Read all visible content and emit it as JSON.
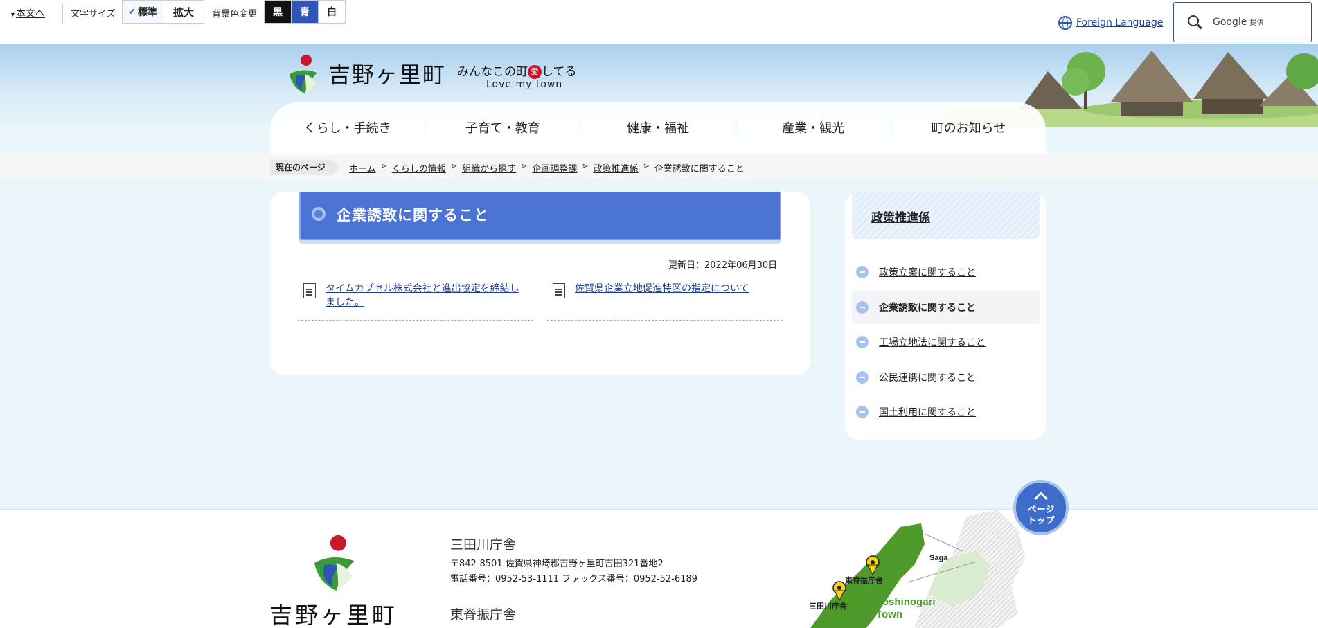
{
  "utility": {
    "skip": "本文へ",
    "font_size_label": "文字サイズ",
    "font_std": "標準",
    "font_big": "拡大",
    "bg_label": "背景色変更",
    "bg_black": "黒",
    "bg_blue": "青",
    "bg_white": "白",
    "foreign": "Foreign Language",
    "search_brand": "Google",
    "search_provided": "提供"
  },
  "header": {
    "logo": "吉野ヶ里町",
    "slogan_pre": "みんなこの町",
    "slogan_heart": "愛",
    "slogan_post": "してる",
    "slogan_en": "Love my town"
  },
  "nav": {
    "items": [
      {
        "label": "くらし・手続き"
      },
      {
        "label": "子育て・教育"
      },
      {
        "label": "健康・福祉"
      },
      {
        "label": "産業・観光"
      },
      {
        "label": "町のお知らせ"
      }
    ]
  },
  "breadcrumb": {
    "here_label": "現在のページ",
    "items": [
      {
        "label": "ホーム"
      },
      {
        "label": "くらしの情報"
      },
      {
        "label": "組織から探す"
      },
      {
        "label": "企画調整課"
      },
      {
        "label": "政策推進係"
      }
    ],
    "current": "企業誘致に関すること",
    "separator": "⋗"
  },
  "main": {
    "title": "企業誘致に関すること",
    "updated": "更新日：2022年06月30日",
    "docs": [
      {
        "label_line1": "タイムカプセル株式会社と進出協定を締結し",
        "label_line2": "ました。"
      },
      {
        "label_line1": "佐賀県企業立地促進特区の指定について",
        "label_line2": ""
      }
    ]
  },
  "sidebar": {
    "title": "政策推進係",
    "items": [
      {
        "label": "政策立案に関すること"
      },
      {
        "label": "企業誘致に関すること"
      },
      {
        "label": "工場立地法に関すること"
      },
      {
        "label": "公民連携に関すること"
      },
      {
        "label": "国土利用に関すること"
      }
    ]
  },
  "pagetop": {
    "line1": "ページ",
    "line2": "トップ"
  },
  "footer": {
    "logo": "吉野ヶ里町",
    "office1": "三田川庁舎",
    "address1": "〒842-8501 佐賀県神埼郡吉野ヶ里町吉田321番地2",
    "phone1": "電話番号：0952-53-1111 ファックス番号：0952-52-6189",
    "office2": "東脊振庁舎",
    "map": {
      "saga": "Saga",
      "pin1": "東脊振庁舎",
      "pin2": "三田川庁舎",
      "town1": "Yoshinogari",
      "town2": "Town"
    }
  },
  "colors": {
    "accent": "#4a73d4",
    "link": "#1e3e8f",
    "bg": "#ebf6fb",
    "logo_red": "#c8182b",
    "logo_green": "#3a9a3a",
    "logo_blue": "#2e55b7",
    "map_green": "#4e9a2a"
  }
}
